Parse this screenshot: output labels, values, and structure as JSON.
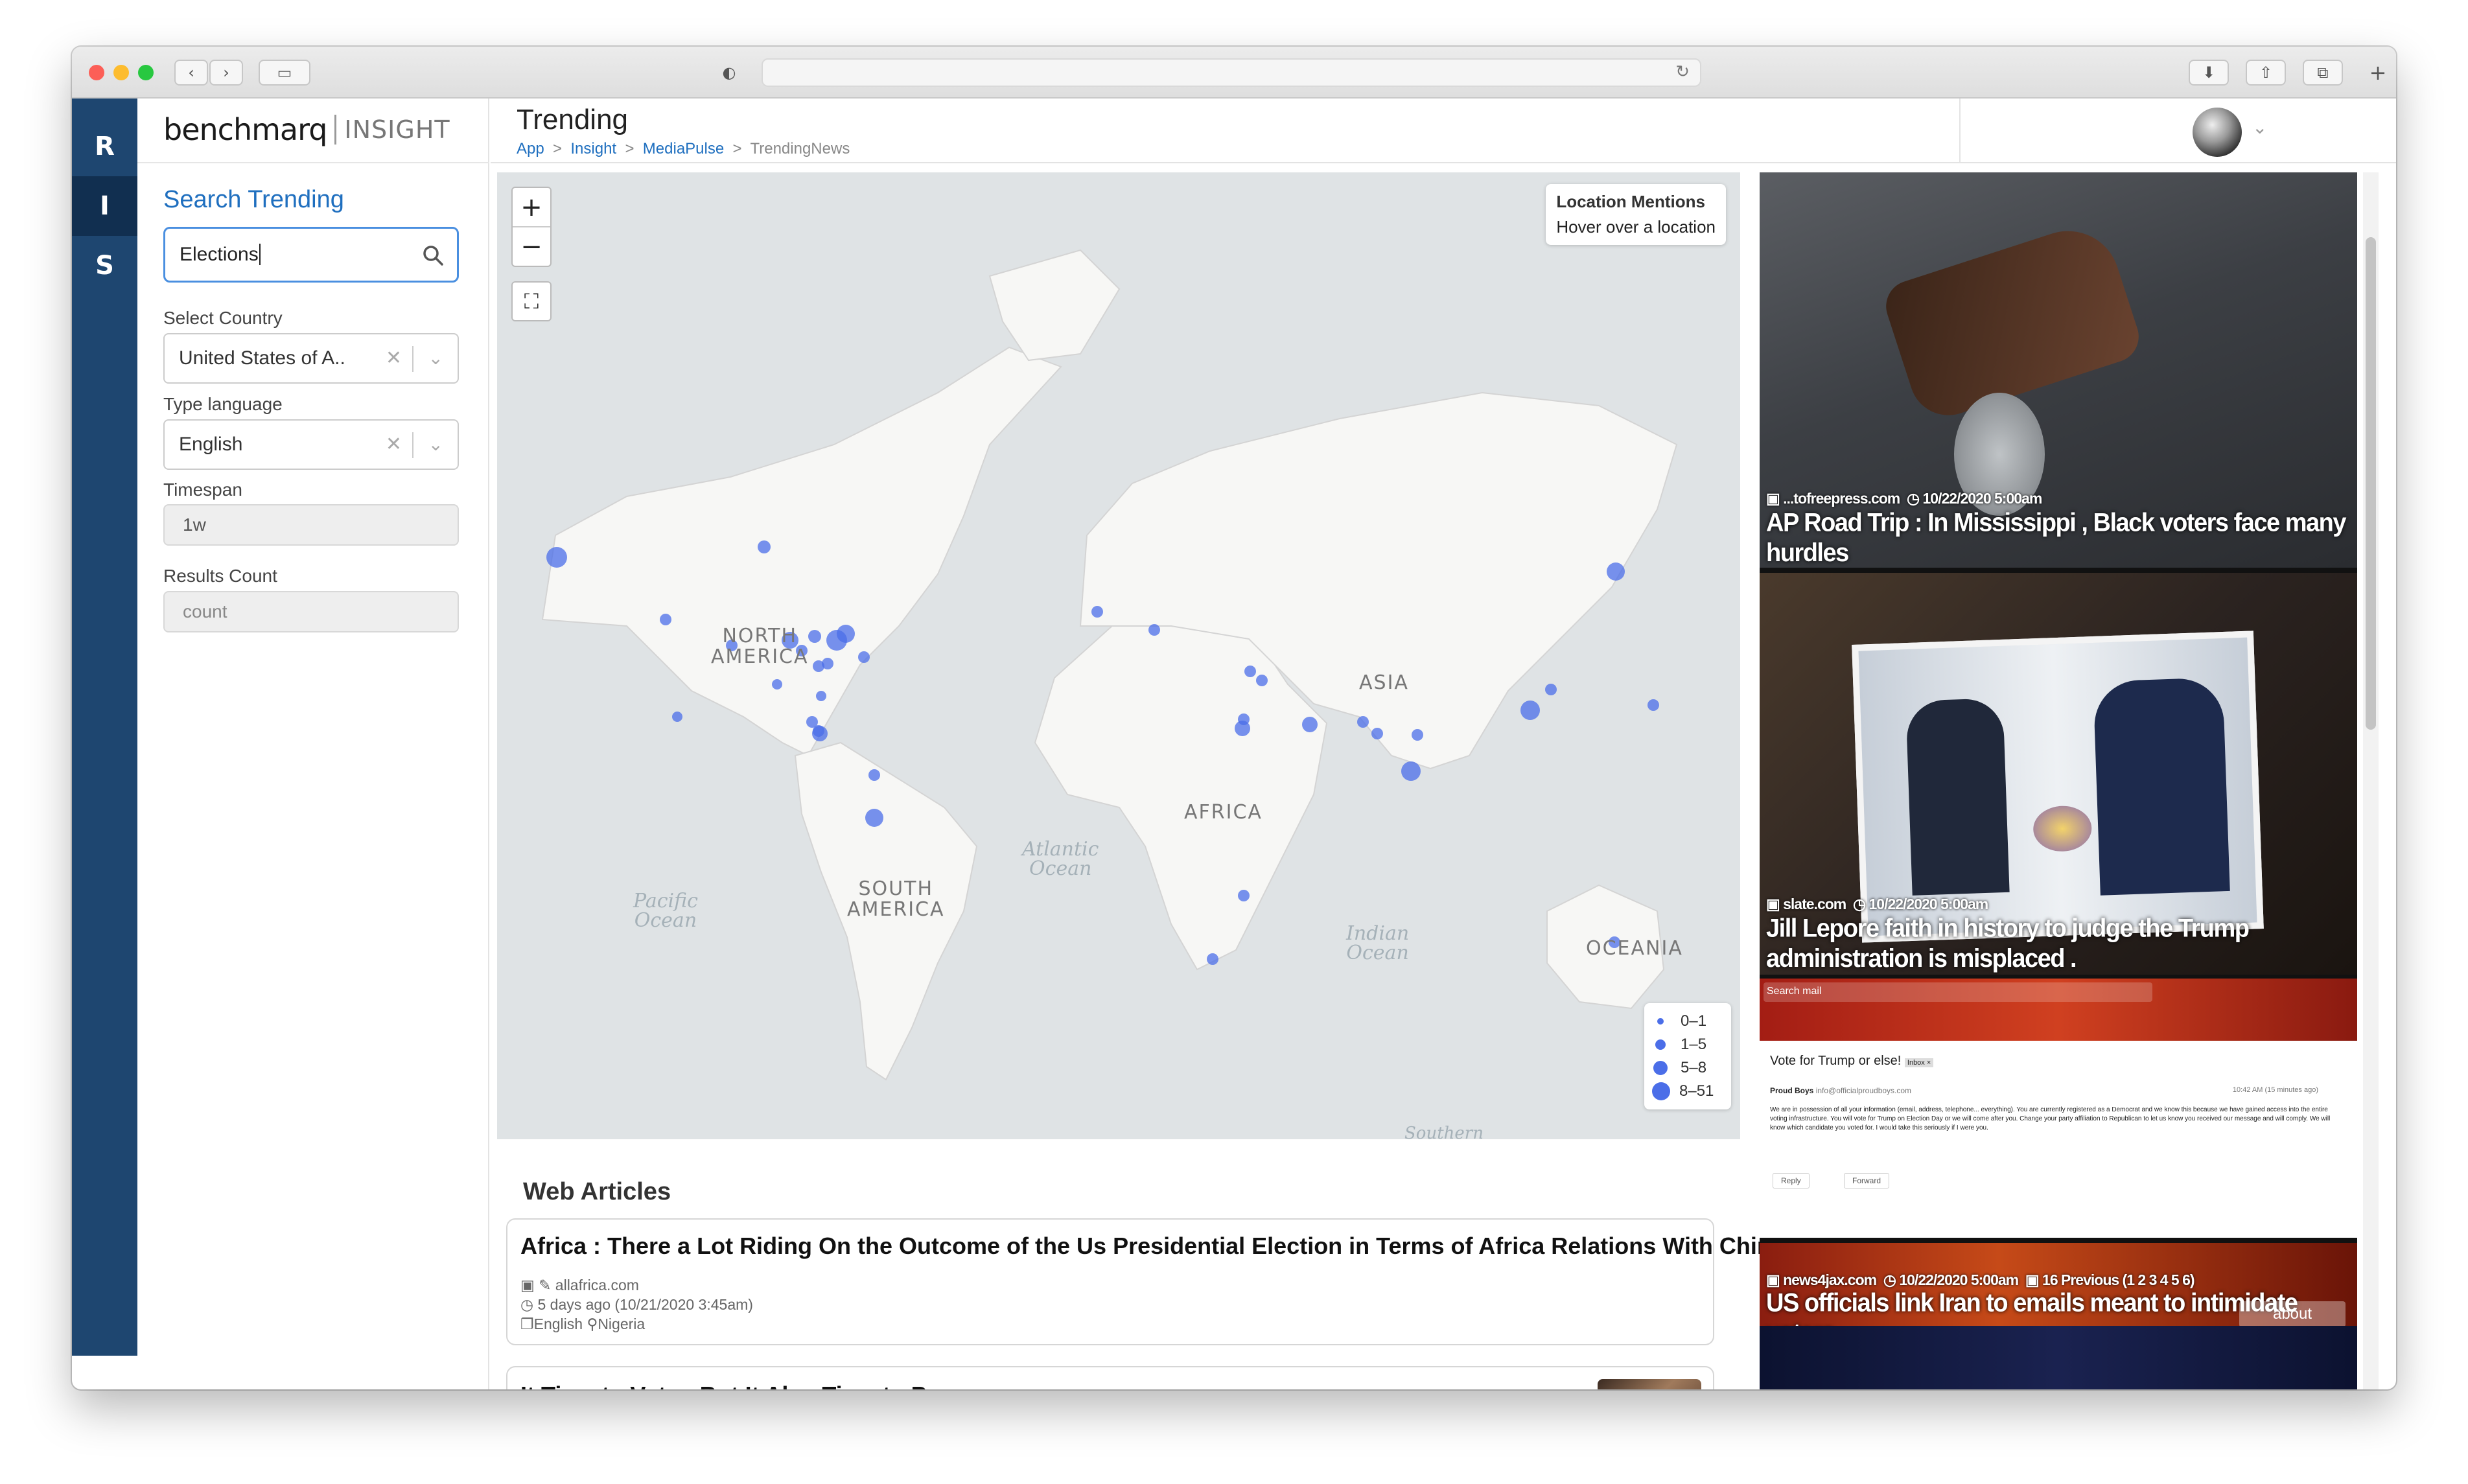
{
  "brand": {
    "name": "benchmarq",
    "product": "INSIGHT"
  },
  "rail": [
    "R",
    "I",
    "S"
  ],
  "sidebar": {
    "title": "Search Trending",
    "search_value": "Elections",
    "country_label": "Select Country",
    "country_value": "United States of A..",
    "language_label": "Type language",
    "language_value": "English",
    "timespan_label": "Timespan",
    "timespan_value": "1w",
    "count_label": "Results Count",
    "count_placeholder": "count"
  },
  "header": {
    "title": "Trending",
    "breadcrumb": [
      "App",
      "Insight",
      "MediaPulse",
      "TrendingNews"
    ]
  },
  "map": {
    "info_title": "Location Mentions",
    "info_sub": "Hover over a location",
    "labels": {
      "north_america": "NORTH\nAMERICA",
      "south_america": "SOUTH\nAMERICA",
      "africa": "AFRICA",
      "asia": "ASIA",
      "oceania": "OCEANIA"
    },
    "oceans": {
      "atlantic": "Atlantic\nOcean",
      "pacific": "Pacific\nOcean",
      "indian": "Indian\nOcean",
      "southern": "Southern"
    },
    "legend": [
      "0–1",
      "1–5",
      "5–8",
      "8–51"
    ],
    "marker_color": "#4b6ee8"
  },
  "web_articles": {
    "heading": "Web Articles",
    "items": [
      {
        "title": "Africa : There a Lot Riding On the Outcome of the Us Presidential Election in Terms of Africa Relations With China",
        "source": "allafrica.com",
        "time": "5 days ago (10/21/2020 3:45am)",
        "language": "English",
        "location": "Nigeria"
      },
      {
        "title": "It Time to Vote : But It Also Time to Pray"
      }
    ]
  },
  "feed": [
    {
      "source": "...tofreepress.com",
      "time": "10/22/2020 5:00am",
      "title": "AP Road Trip : In Mississippi , Black voters face many hurdles"
    },
    {
      "source": "slate.com",
      "time": "10/22/2020 5:00am",
      "title": "Jill Lepore faith in history to judge the Trump administration is misplaced ."
    },
    {
      "email_search": "Search mail",
      "email_subject": "Vote for Trump or else!",
      "email_tag": "Inbox ×",
      "email_from": "Proud Boys",
      "email_addr": "info@officialproudboys.com",
      "email_time": "10:42 AM (15 minutes ago)",
      "email_body": "We are in possession of all your information (email, address, telephone... everything). You are currently registered as a Democrat and we know this because we have gained access into the entire voting infrastructure. You will vote for Trump on Election Day or we will come after you. Change your party affiliation to Republican to let us know you received our message and will comply. We will know which candidate you voted for. I would take this seriously if I were you.",
      "reply": "Reply",
      "forward": "Forward"
    },
    {
      "source": "news4jax.com",
      "time": "10/22/2020 5:00am",
      "extra": "16 Previous (1 2 3 4 5 6)",
      "title": "US officials link Iran to emails meant to intimidate voters",
      "overlay": "about"
    }
  ]
}
